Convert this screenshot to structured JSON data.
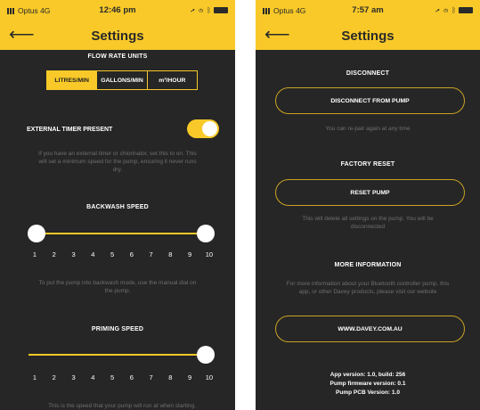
{
  "left": {
    "status": {
      "carrier": "Optus",
      "network": "4G",
      "time": "12:46 pm"
    },
    "header": {
      "title": "Settings"
    },
    "flow_rate": {
      "label": "FLOW RATE UNITS",
      "units": [
        "LITRES/MIN",
        "GALLONS/MIN",
        "m³/HOUR"
      ],
      "selected": "LITRES/MIN"
    },
    "external_timer": {
      "label": "EXTERNAL TIMER PRESENT",
      "enabled": true,
      "help": "If you have an external timer or chlorinator, set this to on. This will set a minimum speed for the pump, ensuring it never runs dry."
    },
    "backwash": {
      "label": "BACKWASH SPEED",
      "range": [
        1,
        10
      ],
      "help": "To put the pump into backwash mode, use the manual dial on the pump."
    },
    "priming": {
      "label": "PRIMING SPEED",
      "value": 10,
      "help": "This is the speed that your pump will run at when starting."
    },
    "ticks": [
      "1",
      "2",
      "3",
      "4",
      "5",
      "6",
      "7",
      "8",
      "9",
      "10"
    ]
  },
  "right": {
    "status": {
      "carrier": "Optus",
      "network": "4G",
      "time": "7:57 am"
    },
    "header": {
      "title": "Settings"
    },
    "disconnect": {
      "label": "DISCONNECT",
      "button": "DISCONNECT FROM PUMP",
      "help": "You can re-pair again at any time"
    },
    "reset": {
      "label": "FACTORY RESET",
      "button": "RESET PUMP",
      "help": "This will delete all settings on the pump. You will be disconnected"
    },
    "info": {
      "label": "MORE INFORMATION",
      "help": "For more information about your Bluetooth controller pump, this app, or other Davey products, please visit our website",
      "button": "WWW.DAVEY.COM.AU"
    },
    "versions": {
      "app": "App version: 1.0, build: 256",
      "firmware": "Pump firmware version: 0.1",
      "pcb": "Pump PCB Version: 1.0"
    }
  },
  "colors": {
    "accent": "#f8c928",
    "background": "#262626",
    "muted_text": "#6f6f6f"
  }
}
